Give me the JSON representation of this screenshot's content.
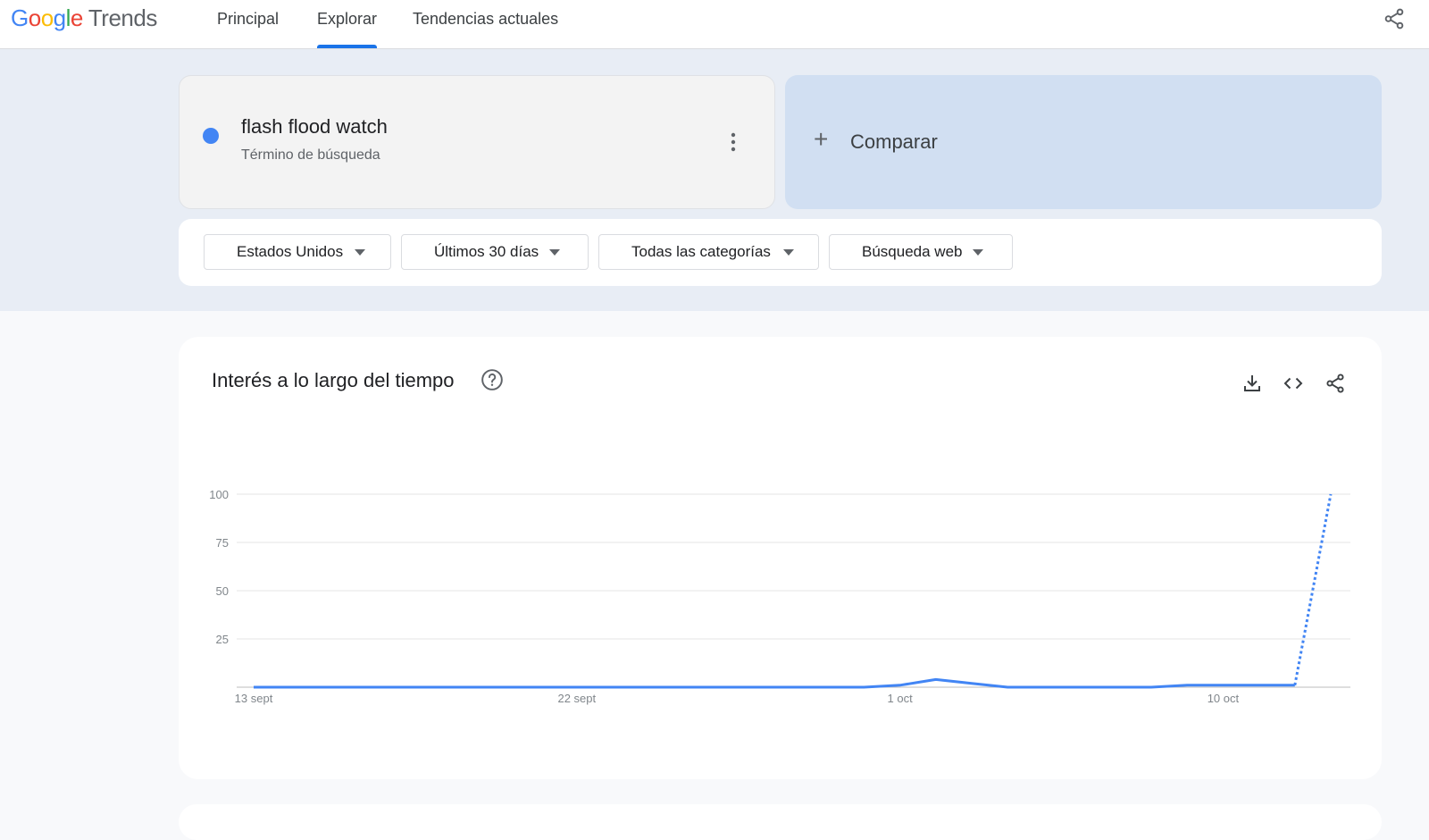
{
  "header": {
    "logo_google": "Google",
    "logo_trends": "Trends",
    "tabs": [
      {
        "label": "Principal",
        "active": false
      },
      {
        "label": "Explorar",
        "active": true
      },
      {
        "label": "Tendencias actuales",
        "active": false
      }
    ],
    "share_icon": "share-icon"
  },
  "search_term": {
    "name": "flash flood watch",
    "type": "Término de búsqueda",
    "color": "#4285f4"
  },
  "compare": {
    "label": "Comparar"
  },
  "filters": [
    {
      "label": "Estados Unidos"
    },
    {
      "label": "Últimos 30 días"
    },
    {
      "label": "Todas las categorías"
    },
    {
      "label": "Búsqueda web"
    }
  ],
  "chart_card": {
    "title": "Interés a lo largo del tiempo",
    "actions": [
      "download-icon",
      "embed-icon",
      "share-icon"
    ]
  },
  "chart_data": {
    "type": "line",
    "title": "",
    "xlabel": "",
    "ylabel": "",
    "ylim": [
      0,
      100
    ],
    "y_ticks": [
      100,
      75,
      50,
      25
    ],
    "x_tick_labels": [
      "13 sept",
      "22 sept",
      "1 oct",
      "10 oct"
    ],
    "x_tick_days": [
      0,
      9,
      18,
      27
    ],
    "grid": true,
    "series": [
      {
        "color": "#4285f4",
        "day": [
          0,
          1,
          2,
          3,
          4,
          5,
          6,
          7,
          8,
          9,
          10,
          11,
          12,
          13,
          14,
          15,
          16,
          17,
          18,
          19,
          20,
          21,
          22,
          23,
          24,
          25,
          26,
          27,
          28,
          29,
          30
        ],
        "values": [
          0,
          0,
          0,
          0,
          0,
          0,
          0,
          0,
          0,
          0,
          0,
          0,
          0,
          0,
          0,
          0,
          0,
          0,
          1,
          4,
          2,
          0,
          0,
          0,
          0,
          0,
          1,
          1,
          1,
          1,
          100
        ],
        "partial_from_day": 29
      }
    ]
  }
}
